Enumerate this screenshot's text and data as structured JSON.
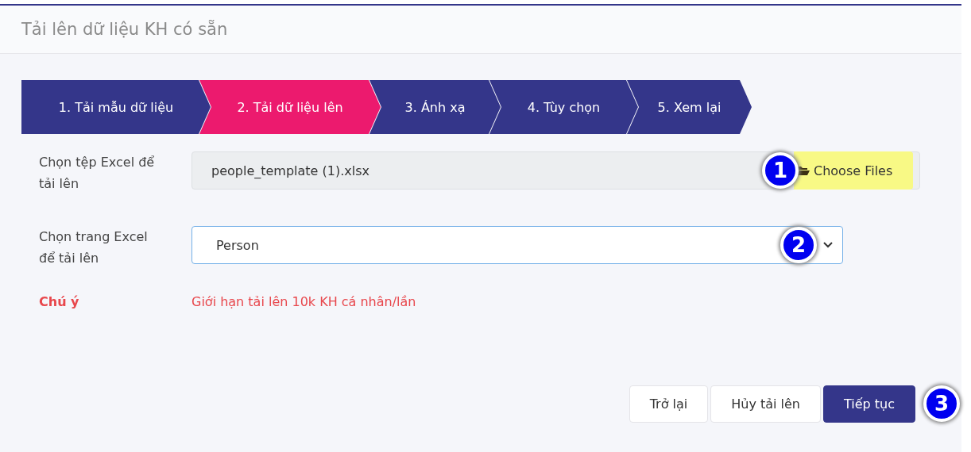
{
  "dialog": {
    "title": "Tải lên dữ liệu KH có sẵn"
  },
  "steps": [
    {
      "label": "1. Tải mẫu dữ liệu",
      "selected": false
    },
    {
      "label": "2. Tải dữ liệu lên",
      "selected": true
    },
    {
      "label": "3. Ánh xạ",
      "selected": false
    },
    {
      "label": "4. Tùy chọn",
      "selected": false
    },
    {
      "label": "5. Xem lại",
      "selected": false
    }
  ],
  "file_field": {
    "label": "Chọn tệp Excel để tải lên",
    "value": "people_template (1).xlsx",
    "button": "Choose Files",
    "callout": "1"
  },
  "sheet_field": {
    "label": "Chọn trang Excel để tải lên",
    "value": "Person",
    "callout": "2"
  },
  "note": {
    "label": "Chú ý",
    "text": "Giới hạn tải lên 10k KH cá nhân/lần"
  },
  "buttons": [
    {
      "label": "Trở lại",
      "kind": "secondary"
    },
    {
      "label": "Hủy tải lên",
      "kind": "secondary"
    },
    {
      "label": "Tiếp tục",
      "kind": "primary"
    }
  ],
  "buttons_callout": "3"
}
